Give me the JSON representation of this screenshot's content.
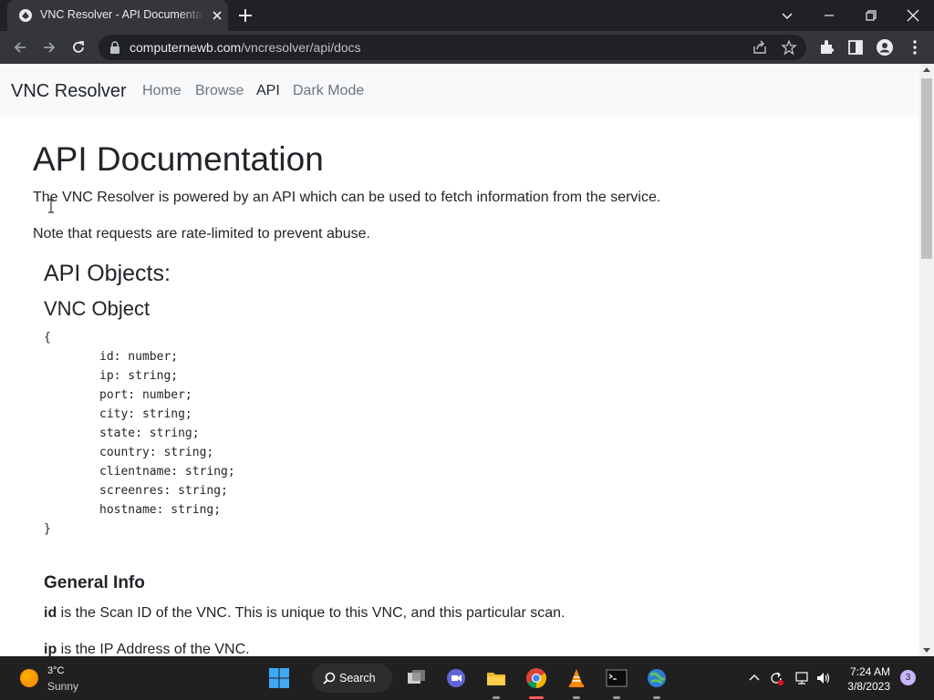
{
  "browser": {
    "tab_title": "VNC Resolver - API Documentation",
    "url_host": "computernewb.com",
    "url_path": "/vncresolver/api/docs"
  },
  "site": {
    "brand": "VNC Resolver",
    "nav": [
      {
        "label": "Home"
      },
      {
        "label": "Browse"
      },
      {
        "label": "API"
      },
      {
        "label": "Dark Mode"
      }
    ]
  },
  "content": {
    "heading": "API Documentation",
    "intro": "The VNC Resolver is powered by an API which can be used to fetch information from the service.",
    "note": "Note that requests are rate-limited to prevent abuse.",
    "objects_heading": "API Objects:",
    "vnc_object_heading": "VNC Object",
    "code_open": "{",
    "code_fields": [
      "id: number;",
      "ip: string;",
      "port: number;",
      "city: string;",
      "state: string;",
      "country: string;",
      "clientname: string;",
      "screenres: string;",
      "hostname: string;"
    ],
    "code_close": "}",
    "general_info_heading": "General Info",
    "info": [
      {
        "field": "id",
        "text": " is the Scan ID of the VNC. This is unique to this VNC, and this particular scan."
      },
      {
        "field": "ip",
        "text": " is the IP Address of the VNC."
      }
    ]
  },
  "taskbar": {
    "temperature": "3°C",
    "condition": "Sunny",
    "search_label": "Search",
    "time": "7:24 AM",
    "date": "3/8/2023",
    "notification_count": "3"
  }
}
